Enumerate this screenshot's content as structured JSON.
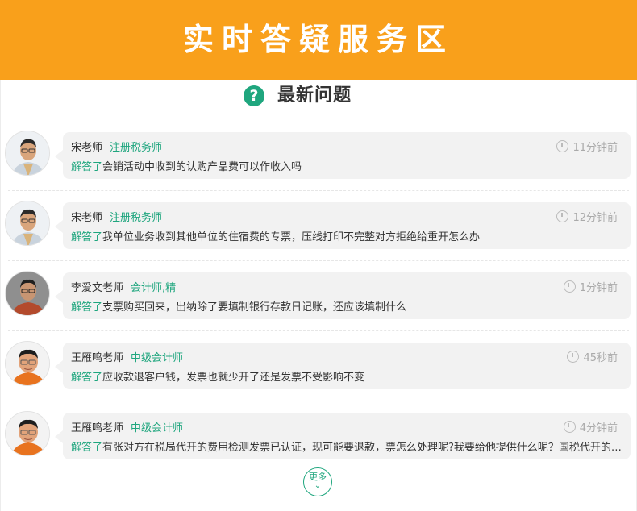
{
  "banner": {
    "title": "实时答疑服务区",
    "color": "#f9a01b"
  },
  "section": {
    "icon": "question-icon",
    "icon_glyph": "?",
    "title": "最新问题"
  },
  "answer_verb": "解答了",
  "questions": [
    {
      "teacher": "宋老师",
      "qualification": "注册税务师",
      "time": "11分钟前",
      "question": "会销活动中收到的认购产品费可以作收入吗"
    },
    {
      "teacher": "宋老师",
      "qualification": "注册税务师",
      "time": "12分钟前",
      "question": "我单位业务收到其他单位的住宿费的专票，压线打印不完整对方拒绝给重开怎么办"
    },
    {
      "teacher": "李爱文老师",
      "qualification": "会计师,精",
      "time": "1分钟前",
      "question": "支票购买回来，出纳除了要填制银行存款日记账，还应该填制什么"
    },
    {
      "teacher": "王雁鸣老师",
      "qualification": "中级会计师",
      "time": "45秒前",
      "question": "应收款退客户钱，发票也就少开了还是发票不受影响不变"
    },
    {
      "teacher": "王雁鸣老师",
      "qualification": "中级会计师",
      "time": "4分钟前",
      "question": "有张对方在税局代开的费用检测发票已认证，现可能要退款，票怎么处理呢?我要给他提供什么呢？国税代开的能否..."
    }
  ],
  "more": {
    "label": "更多",
    "icon": "chevron-down-icon"
  }
}
